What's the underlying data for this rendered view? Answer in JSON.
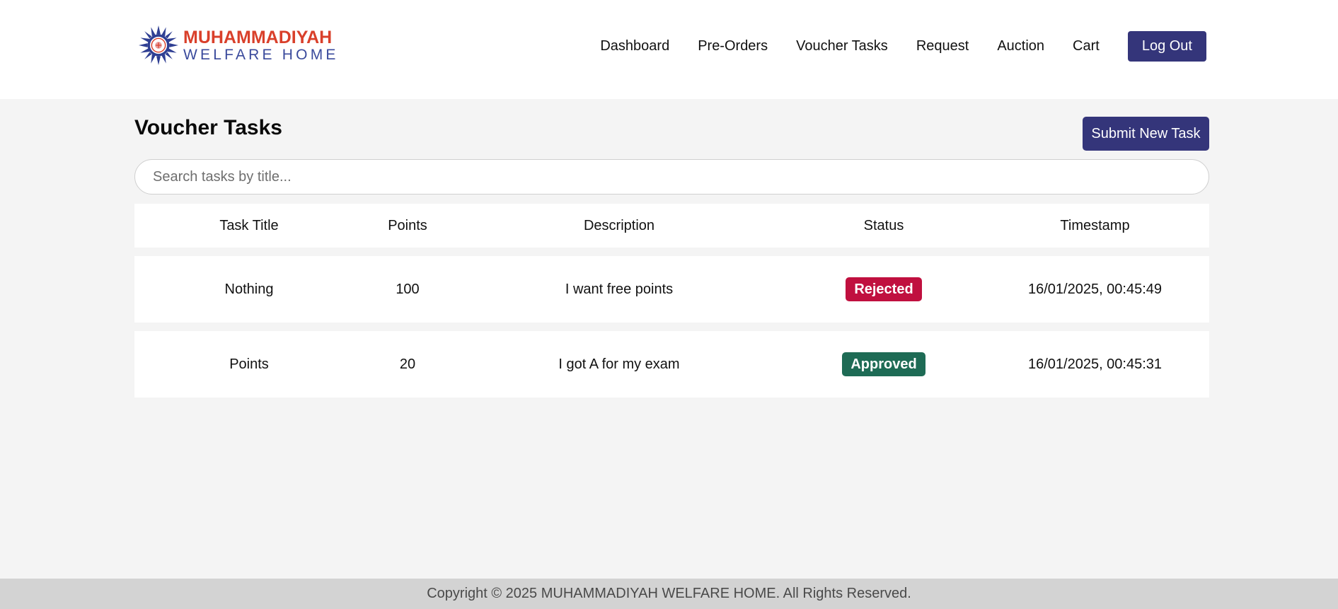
{
  "brand": {
    "name_line1": "MUHAMMADIYAH",
    "name_line2": "WELFARE HOME",
    "colors": {
      "primary_red": "#d9402b",
      "primary_blue": "#3a4a9c"
    },
    "logo_icon": "sun-emblem-icon"
  },
  "nav": {
    "items": [
      {
        "label": "Dashboard"
      },
      {
        "label": "Pre-Orders"
      },
      {
        "label": "Voucher Tasks"
      },
      {
        "label": "Request"
      },
      {
        "label": "Auction"
      },
      {
        "label": "Cart"
      }
    ],
    "logout_label": "Log Out",
    "button_color": "#34357a"
  },
  "page": {
    "title": "Voucher Tasks",
    "submit_label": "Submit New Task"
  },
  "search": {
    "placeholder": "Search tasks by title...",
    "value": ""
  },
  "table": {
    "columns": [
      "Task Title",
      "Points",
      "Description",
      "Status",
      "Timestamp"
    ],
    "rows": [
      {
        "title": "Nothing",
        "points": "100",
        "description": "I want free points",
        "status": "Rejected",
        "status_color": "#c0103f",
        "timestamp": "16/01/2025, 00:45:49"
      },
      {
        "title": "Points",
        "points": "20",
        "description": "I got A for my exam",
        "status": "Approved",
        "status_color": "#1e6b55",
        "timestamp": "16/01/2025, 00:45:31"
      }
    ]
  },
  "footer": {
    "text": "Copyright © 2025 MUHAMMADIYAH WELFARE HOME. All Rights Reserved."
  }
}
